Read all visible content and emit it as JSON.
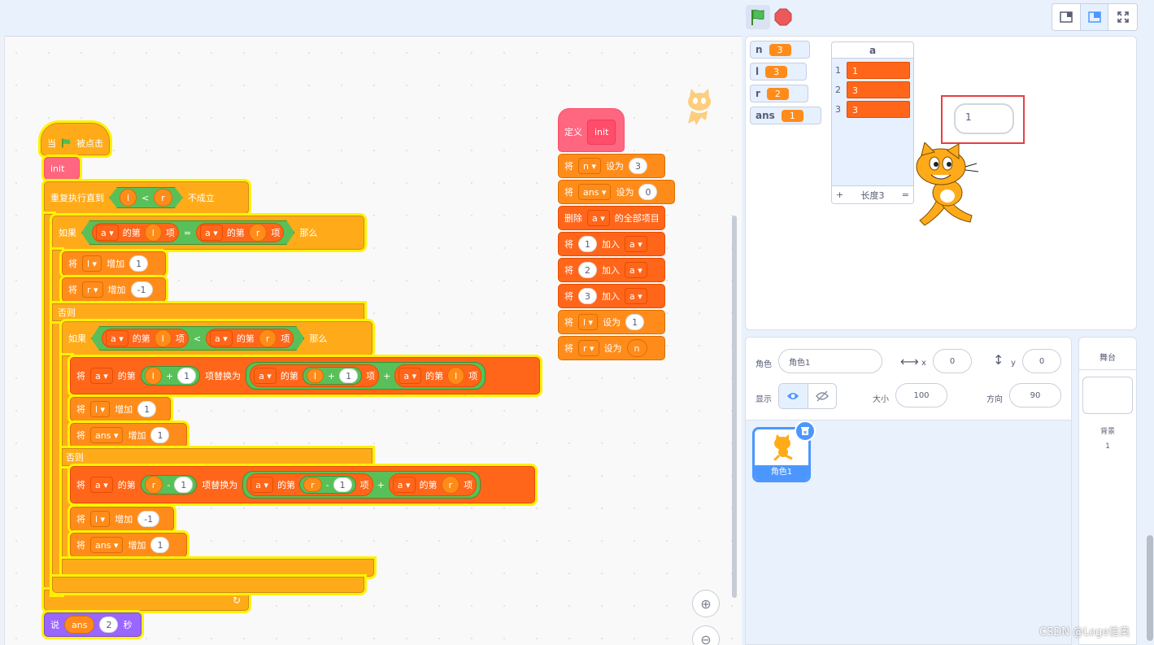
{
  "topbar": {
    "layout_buttons": [
      "small-stage-icon",
      "normal-stage-icon",
      "fullscreen-icon"
    ]
  },
  "colors": {
    "events": "#ffab19",
    "variables": "#ff8c1a",
    "lists": "#ff661a",
    "myblocks": "#ff6680",
    "looks": "#9966ff",
    "operators": "#59c059",
    "glow": "#fff200"
  },
  "script": {
    "when_flag": [
      "当",
      "被点击"
    ],
    "init": "init",
    "repeat_until": {
      "label": "重复执行直到",
      "left": "l",
      "op": "<",
      "right": "r",
      "suffix": "不成立"
    },
    "if1": {
      "kw": "如果",
      "l_list": "a",
      "l_of": "的第",
      "l_idx": "l",
      "l_item": "项",
      "op": "=",
      "r_list": "a",
      "r_of": "的第",
      "r_idx": "r",
      "r_item": "项",
      "then": "那么"
    },
    "chg_l": {
      "kw": "将",
      "var": "l",
      "op": "增加",
      "val": "1"
    },
    "chg_r": {
      "kw": "将",
      "var": "r",
      "op": "增加",
      "val": "-1"
    },
    "else1": "否则",
    "if2": {
      "kw": "如果",
      "l_list": "a",
      "l_of": "的第",
      "l_idx": "l",
      "l_item": "项",
      "op": "<",
      "r_list": "a",
      "r_of": "的第",
      "r_idx": "r",
      "r_item": "项",
      "then": "那么"
    },
    "replace1": {
      "kw": "将",
      "list": "a",
      "of": "的第",
      "idx_v": "l",
      "plus": "+",
      "idx_n": "1",
      "replace": "项替换为",
      "a1": "a",
      "of1": "的第",
      "i1v": "l",
      "i1p": "+",
      "i1n": "1",
      "item1": "项",
      "plus2": "+",
      "a2": "a",
      "of2": "的第",
      "i2v": "l",
      "item2": "项"
    },
    "chg_l2": {
      "kw": "将",
      "var": "l",
      "op": "增加",
      "val": "1"
    },
    "chg_ans": {
      "kw": "将",
      "var": "ans",
      "op": "增加",
      "val": "1"
    },
    "else2": "否则",
    "replace2": {
      "kw": "将",
      "list": "a",
      "of": "的第",
      "idx_v": "r",
      "minus": "-",
      "idx_n": "1",
      "replace": "项替换为",
      "a1": "a",
      "of1": "的第",
      "i1v": "r",
      "i1m": "-",
      "i1n": "1",
      "item1": "项",
      "plus2": "+",
      "a2": "a",
      "of2": "的第",
      "i2v": "r",
      "item2": "项"
    },
    "chg_l3": {
      "kw": "将",
      "var": "l",
      "op": "增加",
      "val": "-1"
    },
    "chg_ans2": {
      "kw": "将",
      "var": "ans",
      "op": "增加",
      "val": "1"
    },
    "say": {
      "kw": "说",
      "var": "ans",
      "secs": "2",
      "unit": "秒"
    }
  },
  "define": {
    "label": "定义",
    "name": "init",
    "rows": [
      {
        "kw": "将",
        "dd": "n",
        "op": "设为",
        "val": "3",
        "type": "set"
      },
      {
        "kw": "将",
        "dd": "ans",
        "op": "设为",
        "val": "0",
        "type": "set"
      },
      {
        "kw": "删除",
        "dd": "a",
        "op": "的全部项目",
        "type": "clear"
      },
      {
        "kw": "将",
        "val": "1",
        "op": "加入",
        "dd": "a",
        "type": "add"
      },
      {
        "kw": "将",
        "val": "2",
        "op": "加入",
        "dd": "a",
        "type": "add"
      },
      {
        "kw": "将",
        "val": "3",
        "op": "加入",
        "dd": "a",
        "type": "add"
      },
      {
        "kw": "将",
        "dd": "l",
        "op": "设为",
        "val": "1",
        "type": "set"
      },
      {
        "kw": "将",
        "dd": "r",
        "op": "设为",
        "val": "n",
        "type": "setvar"
      }
    ]
  },
  "monitors": [
    {
      "name": "n",
      "value": "3"
    },
    {
      "name": "l",
      "value": "3"
    },
    {
      "name": "r",
      "value": "2"
    },
    {
      "name": "ans",
      "value": "1"
    }
  ],
  "list_monitor": {
    "title": "a",
    "items": [
      {
        "idx": "1",
        "val": "1"
      },
      {
        "idx": "2",
        "val": "3"
      },
      {
        "idx": "3",
        "val": "3"
      }
    ],
    "add": "+",
    "length": "长度3",
    "eq": "="
  },
  "bubble": "1",
  "sprite_info": {
    "sprite_label": "角色",
    "sprite_name": "角色1",
    "x_label": "x",
    "x": "0",
    "y_label": "y",
    "y": "0",
    "show_label": "显示",
    "size_label": "大小",
    "size": "100",
    "dir_label": "方向",
    "dir": "90"
  },
  "sprites": [
    {
      "name": "角色1"
    }
  ],
  "stage_panel": {
    "title": "舞台",
    "backdrops_label": "背景",
    "backdrops_count": "1"
  },
  "watermark": "CSDN @Loge信奥"
}
